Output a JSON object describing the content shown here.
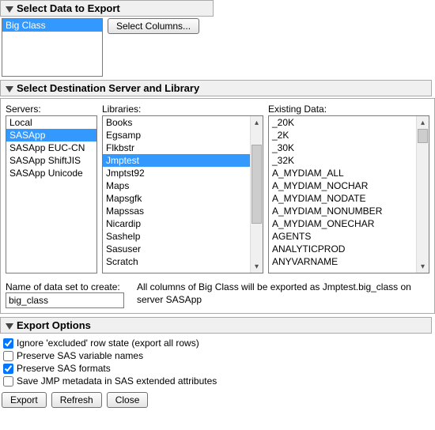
{
  "section1": {
    "title": "Select Data to Export",
    "list": [
      "Big Class"
    ],
    "selected": 0,
    "select_columns_btn": "Select Columns..."
  },
  "section2": {
    "title": "Select Destination Server and Library",
    "servers_label": "Servers:",
    "servers": [
      "Local",
      "SASApp",
      "SASApp EUC-CN",
      "SASApp ShiftJIS",
      "SASApp Unicode"
    ],
    "servers_selected": 1,
    "libraries_label": "Libraries:",
    "libraries": [
      "Books",
      "Egsamp",
      "Flkbstr",
      "Jmptest",
      "Jmptst92",
      "Maps",
      "Mapsgfk",
      "Mapssas",
      "Nicardip",
      "Sashelp",
      "Sasuser",
      "Scratch"
    ],
    "libraries_selected": 3,
    "existing_label": "Existing Data:",
    "existing": [
      "_20K",
      "_2K",
      "_30K",
      "_32K",
      "A_MYDIAM_ALL",
      "A_MYDIAM_NOCHAR",
      "A_MYDIAM_NODATE",
      "A_MYDIAM_NONUMBER",
      "A_MYDIAM_ONECHAR",
      "AGENTS",
      "ANALYTICPROD",
      "ANYVARNAME"
    ],
    "name_label": "Name of data set to create:",
    "name_value": "big_class",
    "status_text": "All columns of Big Class will be exported as Jmptest.big_class on server SASApp"
  },
  "section3": {
    "title": "Export Options",
    "opts": [
      {
        "label": "Ignore 'excluded' row state (export all rows)",
        "checked": true
      },
      {
        "label": "Preserve SAS variable names",
        "checked": false
      },
      {
        "label": "Preserve SAS formats",
        "checked": true
      },
      {
        "label": "Save JMP metadata in SAS extended attributes",
        "checked": false
      }
    ]
  },
  "footer": {
    "export": "Export",
    "refresh": "Refresh",
    "close": "Close"
  }
}
